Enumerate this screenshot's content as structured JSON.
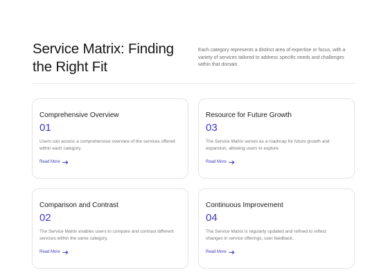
{
  "header": {
    "title": "Service Matrix: Finding the Right Fit",
    "intro": "Each category represents a distinct area of expertise or focus, with a variety of services tailored to address specific needs and challenges within that domain."
  },
  "cards": [
    {
      "title": "Comprehensive Overview",
      "number": "01",
      "description": "Users can access a comprehensive overview of the services offered within each category.",
      "link_label": "Read More",
      "link_icon": "arrow-right-icon"
    },
    {
      "title": "Resource for Future Growth",
      "number": "03",
      "description": "The Service Matrix serves as a roadmap for future growth and expansion, allowing users to explore.",
      "link_label": "Read More",
      "link_icon": "arrow-right-icon"
    },
    {
      "title": "Comparison and Contrast",
      "number": "02",
      "description": "The Service Matrix enables users to compare and contrast different services within the same category.",
      "link_label": "Read More",
      "link_icon": "arrow-right-icon"
    },
    {
      "title": "Continuous Improvement",
      "number": "04",
      "description": "The Service Matrix is regularly updated and refined to reflect changes in service offerings, user feedback.",
      "link_label": "Read More",
      "link_icon": "arrow-right-icon"
    }
  ],
  "colors": {
    "accent": "#3d3ab8",
    "border": "#e4e4e4",
    "muted_text": "#777777"
  }
}
